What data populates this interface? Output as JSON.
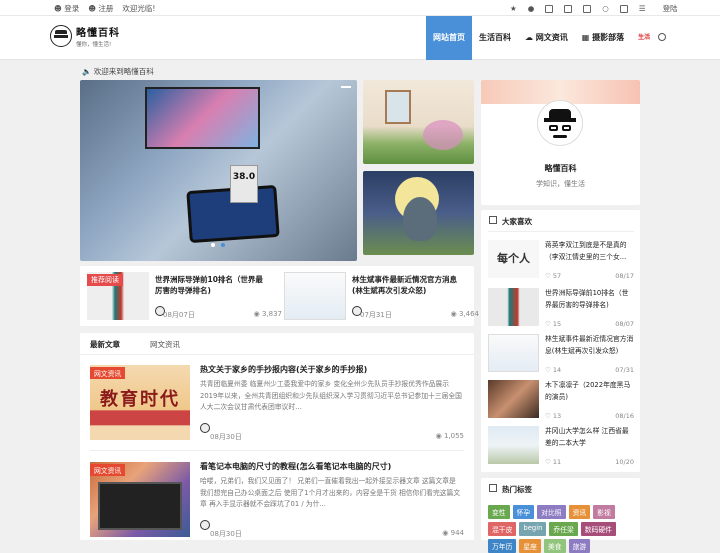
{
  "topbar": {
    "login": "登录",
    "register": "注册",
    "welcome": "欢迎光临!",
    "signin": "登陆"
  },
  "site": {
    "name": "略懂百科",
    "slogan": "懂你，懂生活!"
  },
  "nav": {
    "items": [
      {
        "label": "网站首页"
      },
      {
        "label": "生活百科"
      },
      {
        "label": "网文资讯"
      },
      {
        "label": "摄影部落"
      },
      {
        "label": "生活"
      }
    ]
  },
  "notice": "欢迎来到略懂百科",
  "slider": {
    "meter": "38.0"
  },
  "featured": [
    {
      "badge": "推荐阅读",
      "title": "世界洲际导弹前10排名（世界最厉害的导弹排名)",
      "date": "08月07日",
      "views": "3,837"
    },
    {
      "title": "林生斌事件最新近情况官方消息(林生斌再次引发众怒)",
      "date": "07月31日",
      "views": "3,464"
    }
  ],
  "tabs": [
    "最新文章",
    "网文资讯"
  ],
  "articles": [
    {
      "tag": "网文资讯",
      "thumb_text": "教育时代",
      "title": "热文关于家乡的手抄报内容(关于家乡的手抄报)",
      "desc": "共青团临夏州委 临夏州少工委我爱中的家乡 变化全州少先队员手抄报优秀作品展示2019年以来，全州共青团组织和少先队组织深入学习贯彻习近平总书记参加十三届全国人大二次会议甘肃代表团审议时…",
      "date": "08月30日",
      "views": "1,055"
    },
    {
      "tag": "网文资讯",
      "title": "看笔记本电脑的尺寸的教程(怎么看笔记本电脑的尺寸)",
      "desc": "哈喽，兄弟们，我们又见面了！ 兄弟们一直催着我出一起外接显示器文章 这篇文章是我们想完自己办公桌面之后 使用了1个月才出来的，内容全是干货 相信你们看完这篇文章 再入手显示器就不会踩坑了01 / 为什...",
      "date": "08月30日",
      "views": "944"
    }
  ],
  "profile": {
    "name": "略懂百科",
    "sub": "学知识，懂生活"
  },
  "popular": {
    "title": "大家喜欢",
    "thumb_text": "每个人",
    "items": [
      {
        "title": "蒋英李双江到底是不是真的（李双江情史里的三个女...",
        "likes": "57",
        "date": "08/17"
      },
      {
        "title": "世界洲际导弹前10排名（世界最厉害的导弹排名)",
        "likes": "15",
        "date": "08/07"
      },
      {
        "title": "林生斌事件最新近情况官方消息(林生斌再次引发众怒)",
        "likes": "14",
        "date": "07/31"
      },
      {
        "title": "木下凛凛子（2022年度黑马的演员)",
        "likes": "13",
        "date": "08/16"
      },
      {
        "title": "井冈山大学怎么样 江西省最差的二本大学",
        "likes": "11",
        "date": "10/20"
      }
    ]
  },
  "hot_tags": {
    "title": "热门标签",
    "items": [
      {
        "label": "变性",
        "color": "#6aa84f"
      },
      {
        "label": "怀孕",
        "color": "#4a90d9"
      },
      {
        "label": "对比照",
        "color": "#8e7cc3"
      },
      {
        "label": "资讯",
        "color": "#e69138"
      },
      {
        "label": "影视",
        "color": "#c27ba0"
      },
      {
        "label": "混干皮",
        "color": "#e06666"
      },
      {
        "label": "begin",
        "color": "#76a5af"
      },
      {
        "label": "乔任梁",
        "color": "#6aa84f"
      },
      {
        "label": "数码硬件",
        "color": "#a64d79"
      },
      {
        "label": "万年历",
        "color": "#3d85c6"
      },
      {
        "label": "星座",
        "color": "#e69138"
      },
      {
        "label": "美食",
        "color": "#93c47d"
      },
      {
        "label": "旅游",
        "color": "#8e7cc3"
      }
    ]
  }
}
